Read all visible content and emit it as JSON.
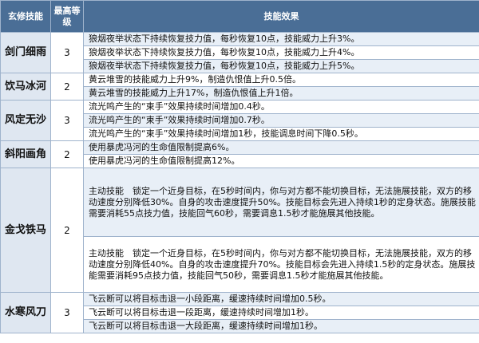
{
  "header": {
    "col_name": "玄修技能",
    "col_level": "最高等级",
    "col_effect": "技能效果"
  },
  "rows": [
    {
      "name": "剑门细雨",
      "level": "3",
      "effects": [
        "狼烟夜举状态下持续恢复技力值，每秒恢复10点，技能威力上升3%。",
        "狼烟夜举状态下持续恢复技力值，每秒恢复10点，技能威力上升4%。",
        "狼烟夜举状态下持续恢复技力值，每秒恢复10点，技能威力上升5%。"
      ]
    },
    {
      "name": "饮马冰河",
      "level": "2",
      "effects": [
        "黄云堆雪的技能威力上升9%，制造仇恨值上升0.5倍。",
        "黄云堆雪的技能威力上升17%，制造仇恨值上升1倍。"
      ]
    },
    {
      "name": "风定无沙",
      "level": "3",
      "effects": [
        "流光鸣产生的“束手”效果持续时间增加0.4秒。",
        "流光鸣产生的“束手”效果持续时间增加0.7秒。",
        "流光鸣产生的“束手”效果持续时间增加1秒，技能调息时间下降0.5秒。"
      ]
    },
    {
      "name": "斜阳画角",
      "level": "2",
      "effects": [
        "使用暴虎冯河的生命值限制提高6%。",
        "使用暴虎冯河的生命值限制提高12%。"
      ]
    },
    {
      "name": "金戈铁马",
      "level": "2",
      "effects": [
        "主动技能　锁定一个近身目标，在5秒时间内，你与对方都不能切换目标，无法施展技能，双方的移动速度分别降低30%。自身的攻击速度提升50%。技能目标会先进入持续1秒的定身状态。施展技能需要消耗55点技力值，技能回气60秒，需要调息1.5秒才能施展其他技能。",
        "主动技能　锁定一个近身目标，在5秒时间内，你与对方都不能切换目标，无法施展技能，双方的移动速度分别降低40%。自身的攻击速度提升70%。技能目标会先进入持续1.5秒的定身状态。施展技能需要消耗95点技力值，技能回气50秒，需要调息1.5秒才能施展其他技能。"
      ]
    },
    {
      "name": "水寒风刀",
      "level": "3",
      "effects": [
        "飞云断可以将目标击退一小段距离，缓速持续时间增加0.5秒。",
        "飞云断可以将目标击退一段距离，缓速持续时间增加1秒。",
        "飞云断可以将目标击退一大段距离，缓速持续时间增加1秒。"
      ]
    }
  ]
}
